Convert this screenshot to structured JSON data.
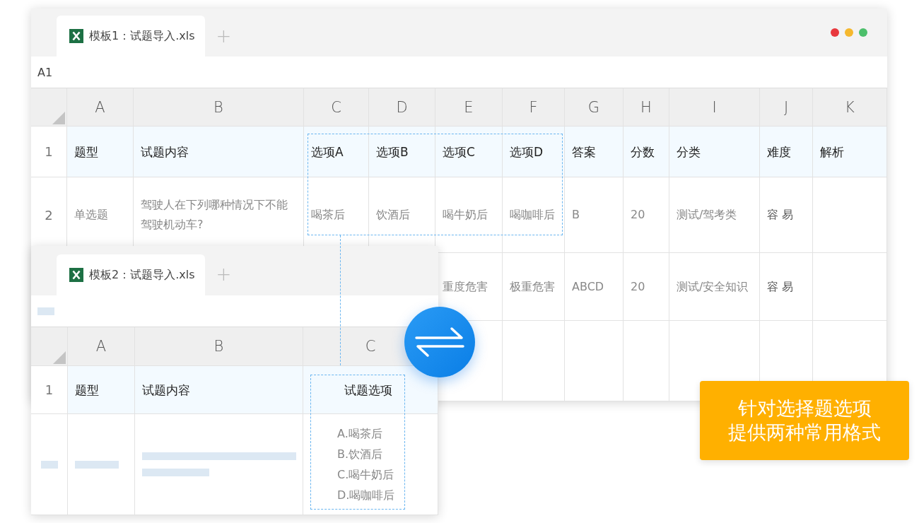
{
  "windows": [
    {
      "tab": {
        "label": "模板1：试题导入.xls",
        "selected": true
      },
      "add_tab": "+",
      "window_controls": [
        {
          "color": "#e8383d"
        },
        {
          "color": "#f5b82e"
        },
        {
          "color": "#4cbf6b"
        }
      ],
      "name_box": "A1",
      "columns": [
        "A",
        "B",
        "C",
        "D",
        "E",
        "F",
        "G",
        "H",
        "I",
        "J",
        "K"
      ],
      "rows": [
        {
          "kind": "heading",
          "number": "1",
          "cells": [
            "题型",
            "试题内容",
            "选项A",
            "选项B",
            "选项C",
            "选项D",
            "答案",
            "分数",
            "分类",
            "难度",
            "解析"
          ]
        },
        {
          "kind": "data",
          "number": "2",
          "cells": [
            "单选题",
            "驾驶人在下列哪种情况下不能驾驶机动车?",
            "喝茶后",
            "饮酒后",
            "喝牛奶后",
            "喝咖啡后",
            "B",
            "20",
            "测试/驾考类",
            "容 易",
            null
          ]
        },
        {
          "kind": "data",
          "cells": [
            null,
            null,
            null,
            null,
            "重度危害",
            "极重危害",
            "ABCD",
            "20",
            "测试/安全知识",
            "容 易",
            null
          ]
        }
      ]
    },
    {
      "tab": {
        "label": "模板2：试题导入.xls",
        "selected": true
      },
      "add_tab": "+",
      "columns": [
        "A",
        "B",
        "C"
      ],
      "rows": [
        {
          "kind": "heading",
          "number": "1",
          "cells": [
            "题型",
            "试题内容",
            "试题选项"
          ]
        },
        {
          "kind": "placeholder",
          "options": [
            "A.喝茶后",
            "B.饮酒后",
            "C.喝牛奶后",
            "D.喝咖啡后"
          ]
        }
      ]
    }
  ],
  "callout": {
    "lines": [
      "针对选择题选项",
      "提供两种常用格式"
    ]
  }
}
